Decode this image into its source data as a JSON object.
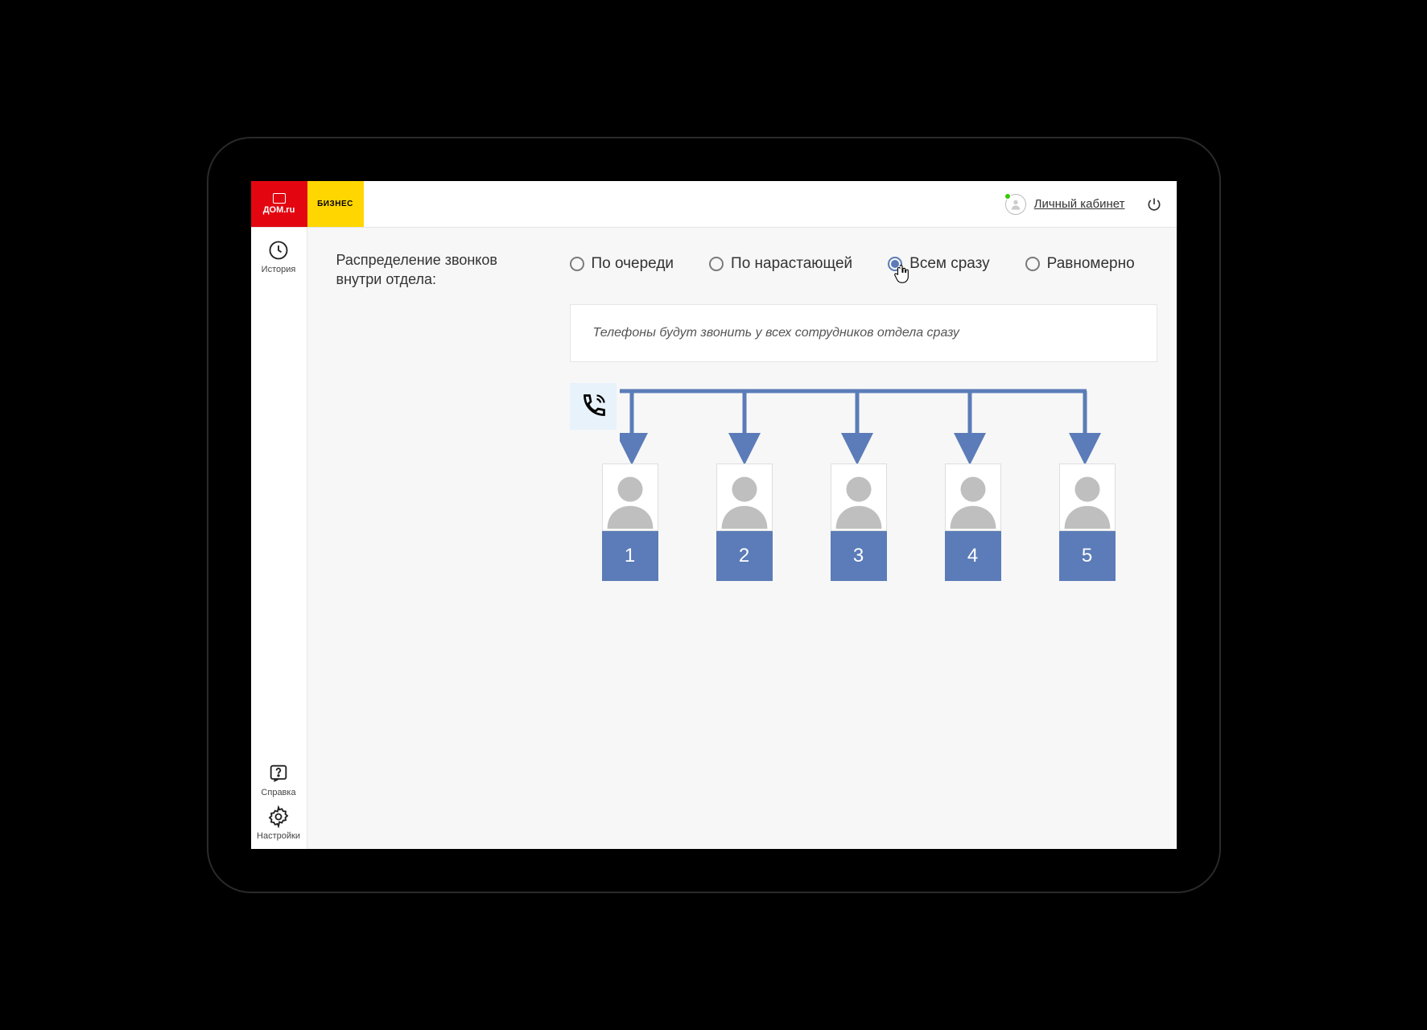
{
  "brand": {
    "left": "ДОМ.ru",
    "right": "БИЗНЕС"
  },
  "header": {
    "account_link": "Личный кабинет"
  },
  "sidebar": {
    "history": "История",
    "help": "Справка",
    "settings": "Настройки"
  },
  "distribution": {
    "label": "Распределение звонков внутри отдела:",
    "options": [
      {
        "id": "queue",
        "label": "По очереди",
        "selected": false
      },
      {
        "id": "growing",
        "label": "По нарастающей",
        "selected": false
      },
      {
        "id": "all",
        "label": "Всем сразу",
        "selected": true
      },
      {
        "id": "even",
        "label": "Равномерно",
        "selected": false
      }
    ],
    "description": "Телефоны будут звонить у всех сотрудников отдела сразу",
    "people": [
      "1",
      "2",
      "3",
      "4",
      "5"
    ]
  },
  "colors": {
    "accent": "#5b7cb8"
  }
}
